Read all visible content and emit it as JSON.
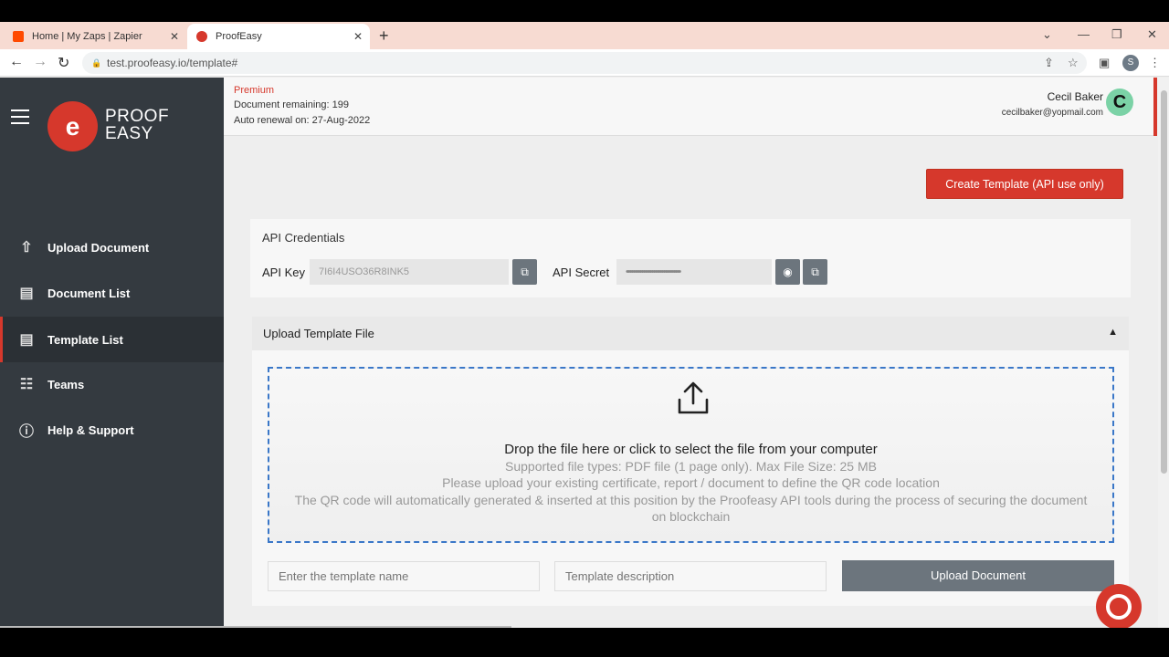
{
  "browser": {
    "tabs": [
      {
        "title": "Home | My Zaps | Zapier"
      },
      {
        "title": "ProofEasy"
      }
    ],
    "url": "test.proofeasy.io/template#",
    "profile_initial": "S"
  },
  "sidebar": {
    "logo_line1": "PROOF",
    "logo_line2": "EASY",
    "items": [
      {
        "label": "Upload Document"
      },
      {
        "label": "Document List"
      },
      {
        "label": "Template List"
      },
      {
        "label": "Teams"
      },
      {
        "label": "Help & Support"
      }
    ]
  },
  "account": {
    "plan": "Premium",
    "documents_remaining": "Document remaining: 199",
    "auto_renewal": "Auto renewal on: 27-Aug-2022",
    "user_name": "Cecil Baker",
    "user_email": "cecilbaker@yopmail.com",
    "avatar_initial": "C"
  },
  "main": {
    "create_button": "Create Template (API use only)",
    "credentials": {
      "title": "API Credentials",
      "api_key_label": "API Key",
      "api_key_value": "7I6I4USO36R8INK5",
      "api_secret_label": "API Secret",
      "api_secret_value": "••••••••••••••••••••••••••••••••"
    },
    "upload": {
      "title": "Upload Template File",
      "drop_text": "Drop the file here or click to select the file from your computer",
      "supported": "Supported file types: PDF file (1 page only). Max File Size: 25 MB",
      "hint1": "Please upload your existing certificate, report / document to define the QR code location",
      "hint2": "The QR code will automatically generated & inserted at this position by the Proofeasy API tools during the process of securing the document on blockchain",
      "name_placeholder": "Enter the template name",
      "desc_placeholder": "Template description",
      "upload_button": "Upload Document"
    }
  },
  "colors": {
    "brand": "#d6382c",
    "sidebar": "#343a40",
    "button_gray": "#6c757d"
  }
}
